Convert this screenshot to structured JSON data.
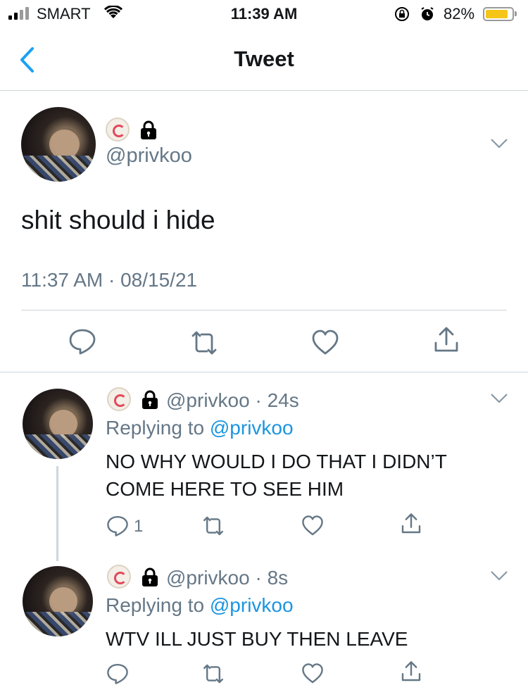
{
  "status_bar": {
    "carrier": "SMART",
    "time": "11:39 AM",
    "battery_percent": "82%",
    "battery_level": 0.82,
    "battery_color": "#f5c518"
  },
  "nav": {
    "back_icon": "chevron-left-icon",
    "title": "Tweet"
  },
  "main_tweet": {
    "handle": "@privkoo",
    "text": "shit should i hide",
    "timestamp": "11:37 AM · 08/15/21",
    "actions": [
      "reply-icon",
      "retweet-icon",
      "like-icon",
      "share-icon"
    ]
  },
  "replies": [
    {
      "handle_time": "@privkoo · 24s",
      "replying_prefix": "Replying to ",
      "replying_to": "@privkoo",
      "text": "NO WHY WOULD I DO THAT I DIDN’T COME HERE TO SEE HIM",
      "reply_count": "1"
    },
    {
      "handle_time": "@privkoo · 8s",
      "replying_prefix": "Replying to ",
      "replying_to": "@privkoo",
      "text": "WTV ILL JUST BUY THEN LEAVE",
      "reply_count": ""
    }
  ],
  "colors": {
    "link": "#1b95e0",
    "secondary_text": "#657786",
    "accent": "#1da1f2"
  }
}
